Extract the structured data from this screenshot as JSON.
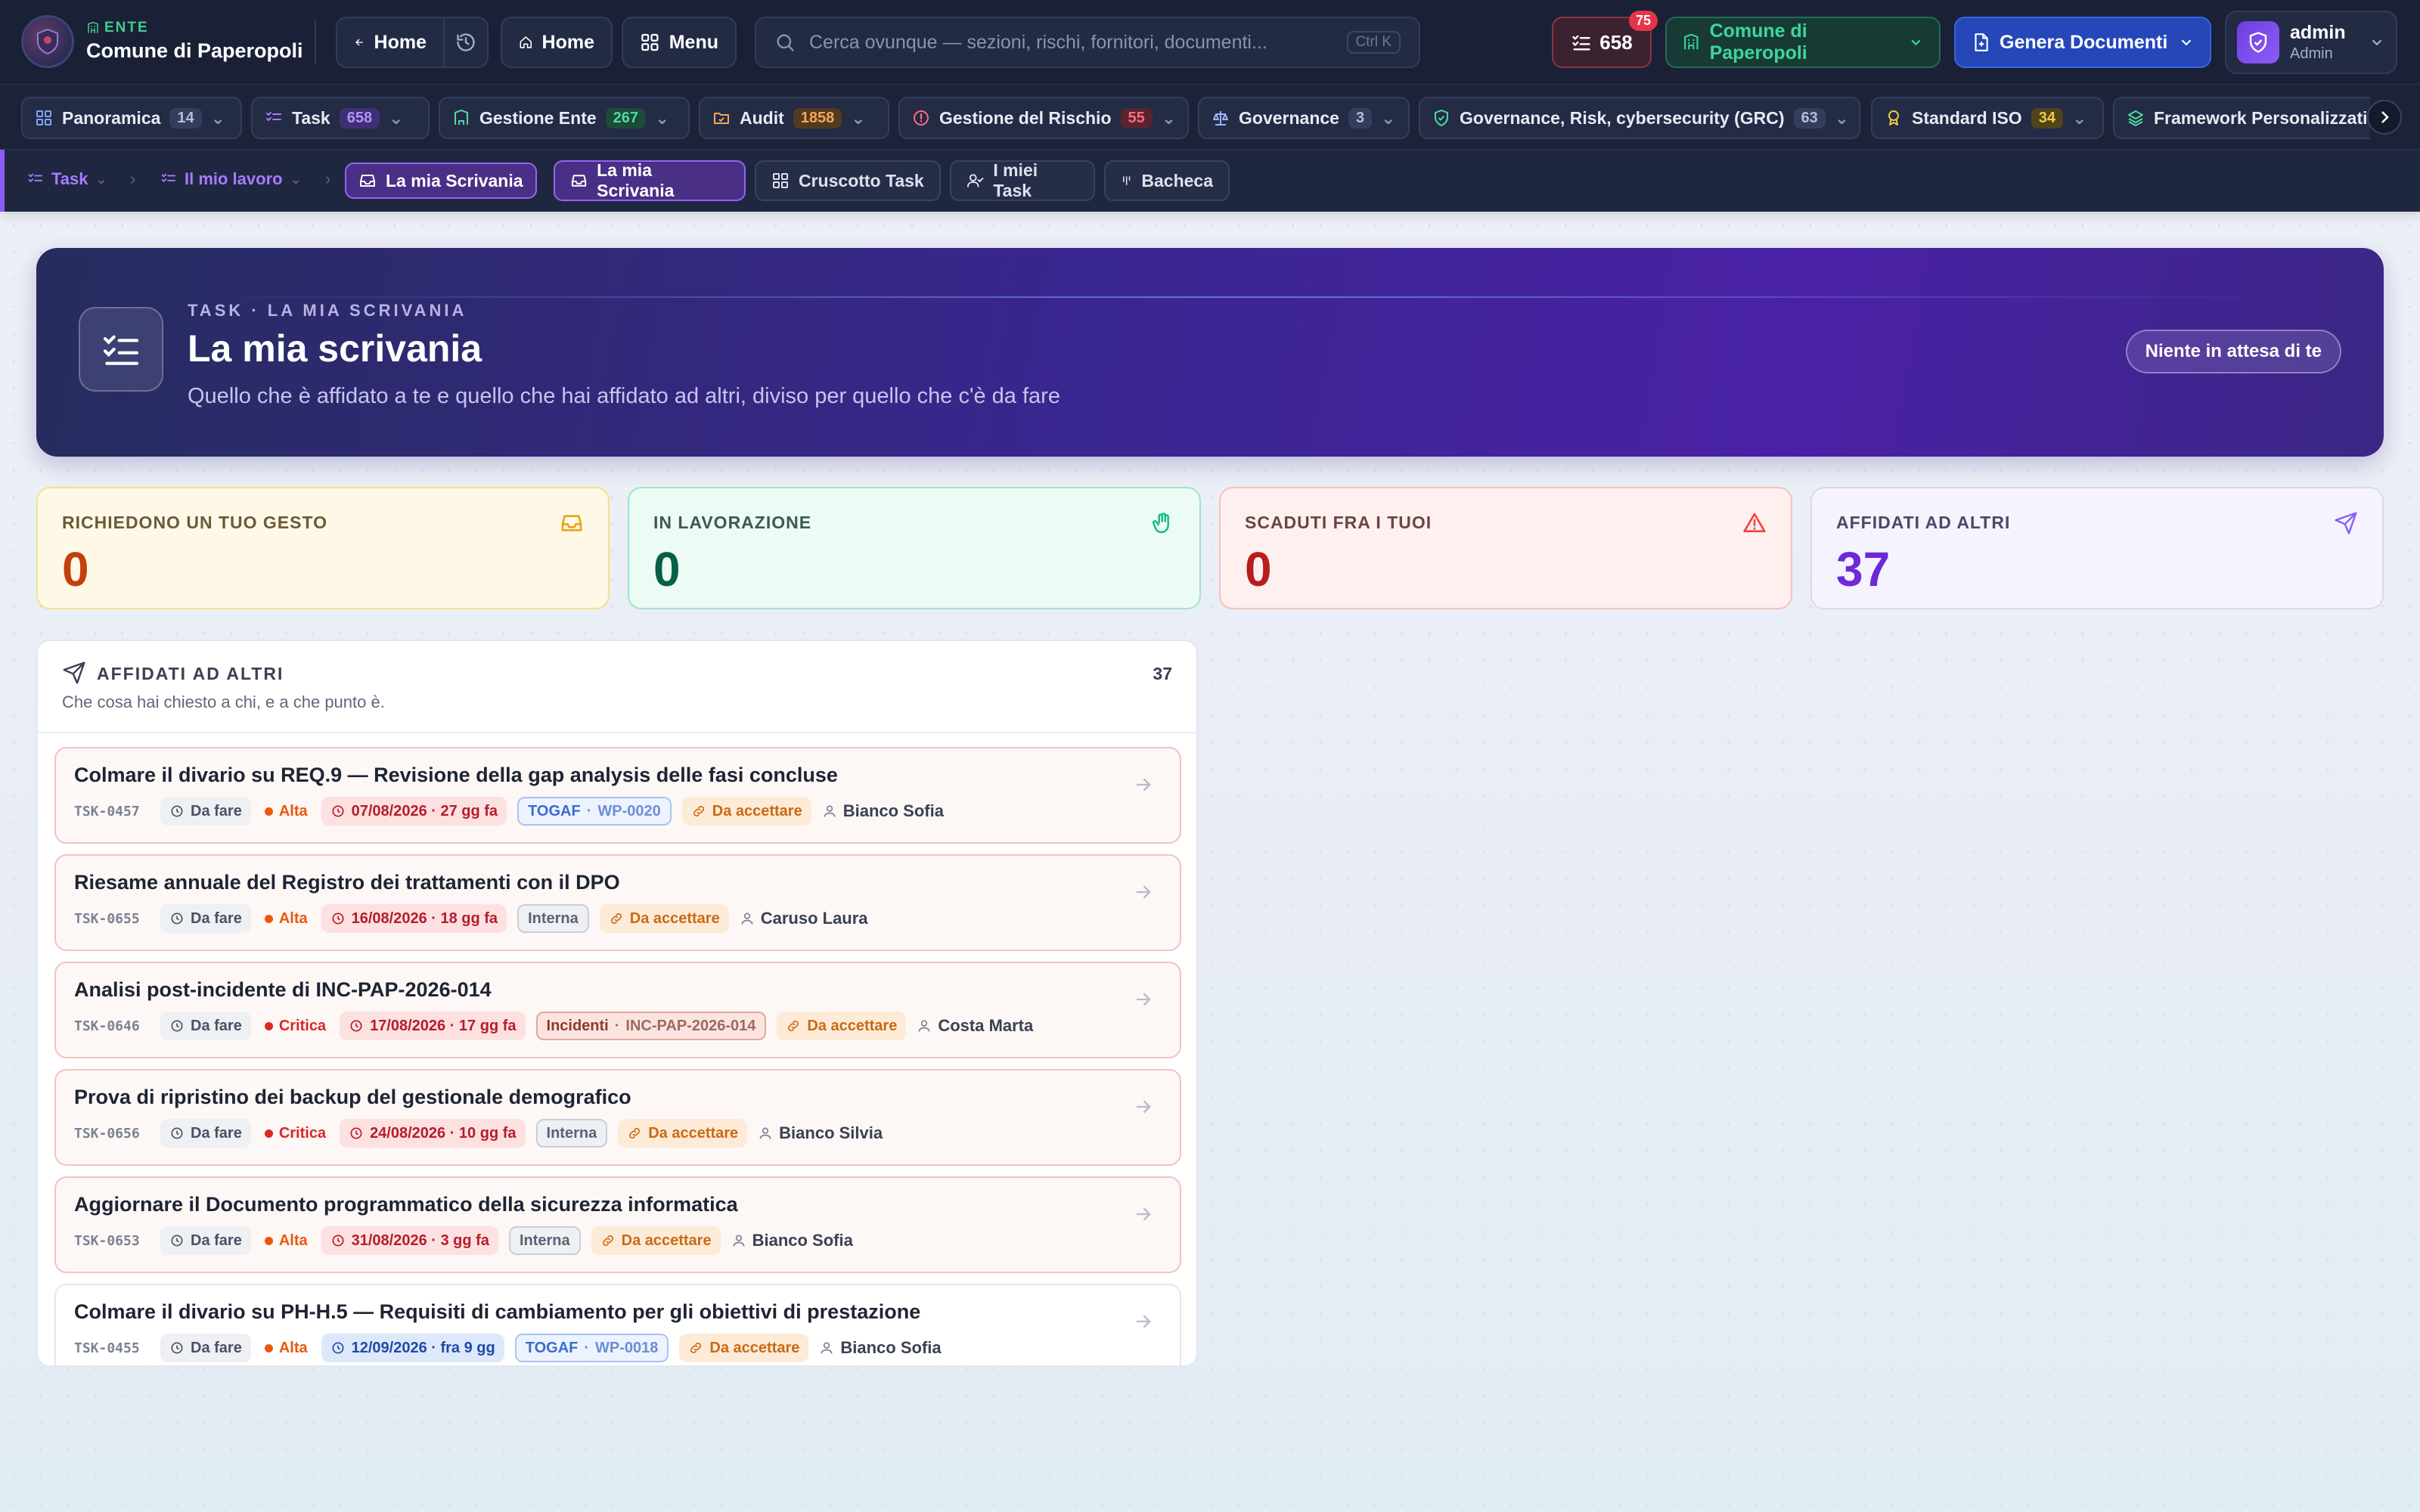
{
  "topbar": {
    "org_tag": "ENTE",
    "org_name": "Comune di Paperopoli",
    "back_label": "Home",
    "home_label": "Home",
    "menu_label": "Menu",
    "search_placeholder": "Cerca ovunque — sezioni, rischi, fornitori, documenti...",
    "search_shortcut": "Ctrl K",
    "task_count": "658",
    "notif_count": "75",
    "entity_selector": "Comune di Paperopoli",
    "generate_label": "Genera Documenti",
    "user_name": "admin",
    "user_role": "Admin"
  },
  "modules": [
    {
      "label": "Panoramica",
      "count": "14",
      "color": "gray",
      "icon": "grid-icon"
    },
    {
      "label": "Task",
      "count": "658",
      "color": "purple",
      "icon": "checklist-icon"
    },
    {
      "label": "Gestione Ente",
      "count": "267",
      "color": "green",
      "icon": "building-icon"
    },
    {
      "label": "Audit",
      "count": "1858",
      "color": "orange",
      "icon": "folder-check-icon"
    },
    {
      "label": "Gestione del Rischio",
      "count": "55",
      "color": "red",
      "icon": "alert-circle-icon"
    },
    {
      "label": "Governance",
      "count": "3",
      "color": "gray",
      "icon": "scale-icon"
    },
    {
      "label": "Governance, Risk, cybersecurity (GRC)",
      "count": "63",
      "color": "gray",
      "icon": "shield-check-icon"
    },
    {
      "label": "Standard ISO",
      "count": "34",
      "color": "yellow",
      "icon": "award-icon"
    },
    {
      "label": "Framework Personalizzati",
      "count": "",
      "color": "gray",
      "icon": "layers-icon"
    }
  ],
  "subnav": {
    "crumb1": "Task",
    "crumb2": "Il mio lavoro",
    "crumb3": "La mia Scrivania",
    "tabs": [
      "La mia Scrivania",
      "Cruscotto Task",
      "I miei Task",
      "Bacheca"
    ]
  },
  "hero": {
    "eyebrow": "TASK · LA MIA SCRIVANIA",
    "title": "La mia scrivania",
    "subtitle": "Quello che è affidato a te e quello che hai affidato ad altri, diviso per quello che c'è da fare",
    "status_button": "Niente in attesa di te"
  },
  "stats": [
    {
      "label": "RICHIEDONO UN TUO GESTO",
      "value": "0",
      "icon": "inbox-icon"
    },
    {
      "label": "IN LAVORAZIONE",
      "value": "0",
      "icon": "hand-icon"
    },
    {
      "label": "SCADUTI FRA I TUOI",
      "value": "0",
      "icon": "warning-triangle-icon"
    },
    {
      "label": "AFFIDATI AD ALTRI",
      "value": "37",
      "icon": "send-icon"
    }
  ],
  "panel": {
    "title": "AFFIDATI AD ALTRI",
    "count": "37",
    "subtitle": "Che cosa hai chiesto a chi, e a che punto è.",
    "items": [
      {
        "title": "Colmare il divario su REQ.9 — Revisione della gap analysis delle fasi concluse",
        "code": "TSK-0457",
        "status": "Da fare",
        "priority": "Alta",
        "due": "07/08/2026 · 27 gg fa",
        "due_state": "overdue",
        "ref_type": "TOGAF",
        "ref_code": "WP-0020",
        "acceptance": "Da accettare",
        "assignee": "Bianco Sofia"
      },
      {
        "title": "Riesame annuale del Registro dei trattamenti con il DPO",
        "code": "TSK-0655",
        "status": "Da fare",
        "priority": "Alta",
        "due": "16/08/2026 · 18 gg fa",
        "due_state": "overdue",
        "ref_type": "Interna",
        "ref_code": "",
        "acceptance": "Da accettare",
        "assignee": "Caruso Laura"
      },
      {
        "title": "Analisi post-incidente di INC-PAP-2026-014",
        "code": "TSK-0646",
        "status": "Da fare",
        "priority": "Critica",
        "due": "17/08/2026 · 17 gg fa",
        "due_state": "overdue",
        "ref_type": "Incidenti",
        "ref_code": "INC-PAP-2026-014",
        "acceptance": "Da accettare",
        "assignee": "Costa Marta"
      },
      {
        "title": "Prova di ripristino dei backup del gestionale demografico",
        "code": "TSK-0656",
        "status": "Da fare",
        "priority": "Critica",
        "due": "24/08/2026 · 10 gg fa",
        "due_state": "overdue",
        "ref_type": "Interna",
        "ref_code": "",
        "acceptance": "Da accettare",
        "assignee": "Bianco Silvia"
      },
      {
        "title": "Aggiornare il Documento programmatico della sicurezza informatica",
        "code": "TSK-0653",
        "status": "Da fare",
        "priority": "Alta",
        "due": "31/08/2026 · 3 gg fa",
        "due_state": "overdue",
        "ref_type": "Interna",
        "ref_code": "",
        "acceptance": "Da accettare",
        "assignee": "Bianco Sofia"
      },
      {
        "title": "Colmare il divario su PH-H.5 — Requisiti di cambiamento per gli obiettivi di prestazione",
        "code": "TSK-0455",
        "status": "Da fare",
        "priority": "Alta",
        "due": "12/09/2026 · fra 9 gg",
        "due_state": "upcoming",
        "ref_type": "TOGAF",
        "ref_code": "WP-0018",
        "acceptance": "Da accettare",
        "assignee": "Bianco Sofia"
      }
    ]
  },
  "colors": {
    "accent_purple": "#8b5cf6",
    "overdue_red": "#b51d2c",
    "priority_alta": "#ea580c",
    "priority_critica": "#dc2626",
    "stat_orange": "#c2410c",
    "stat_green": "#065f46",
    "stat_red": "#b91c1c",
    "stat_purple": "#6d28d9"
  }
}
